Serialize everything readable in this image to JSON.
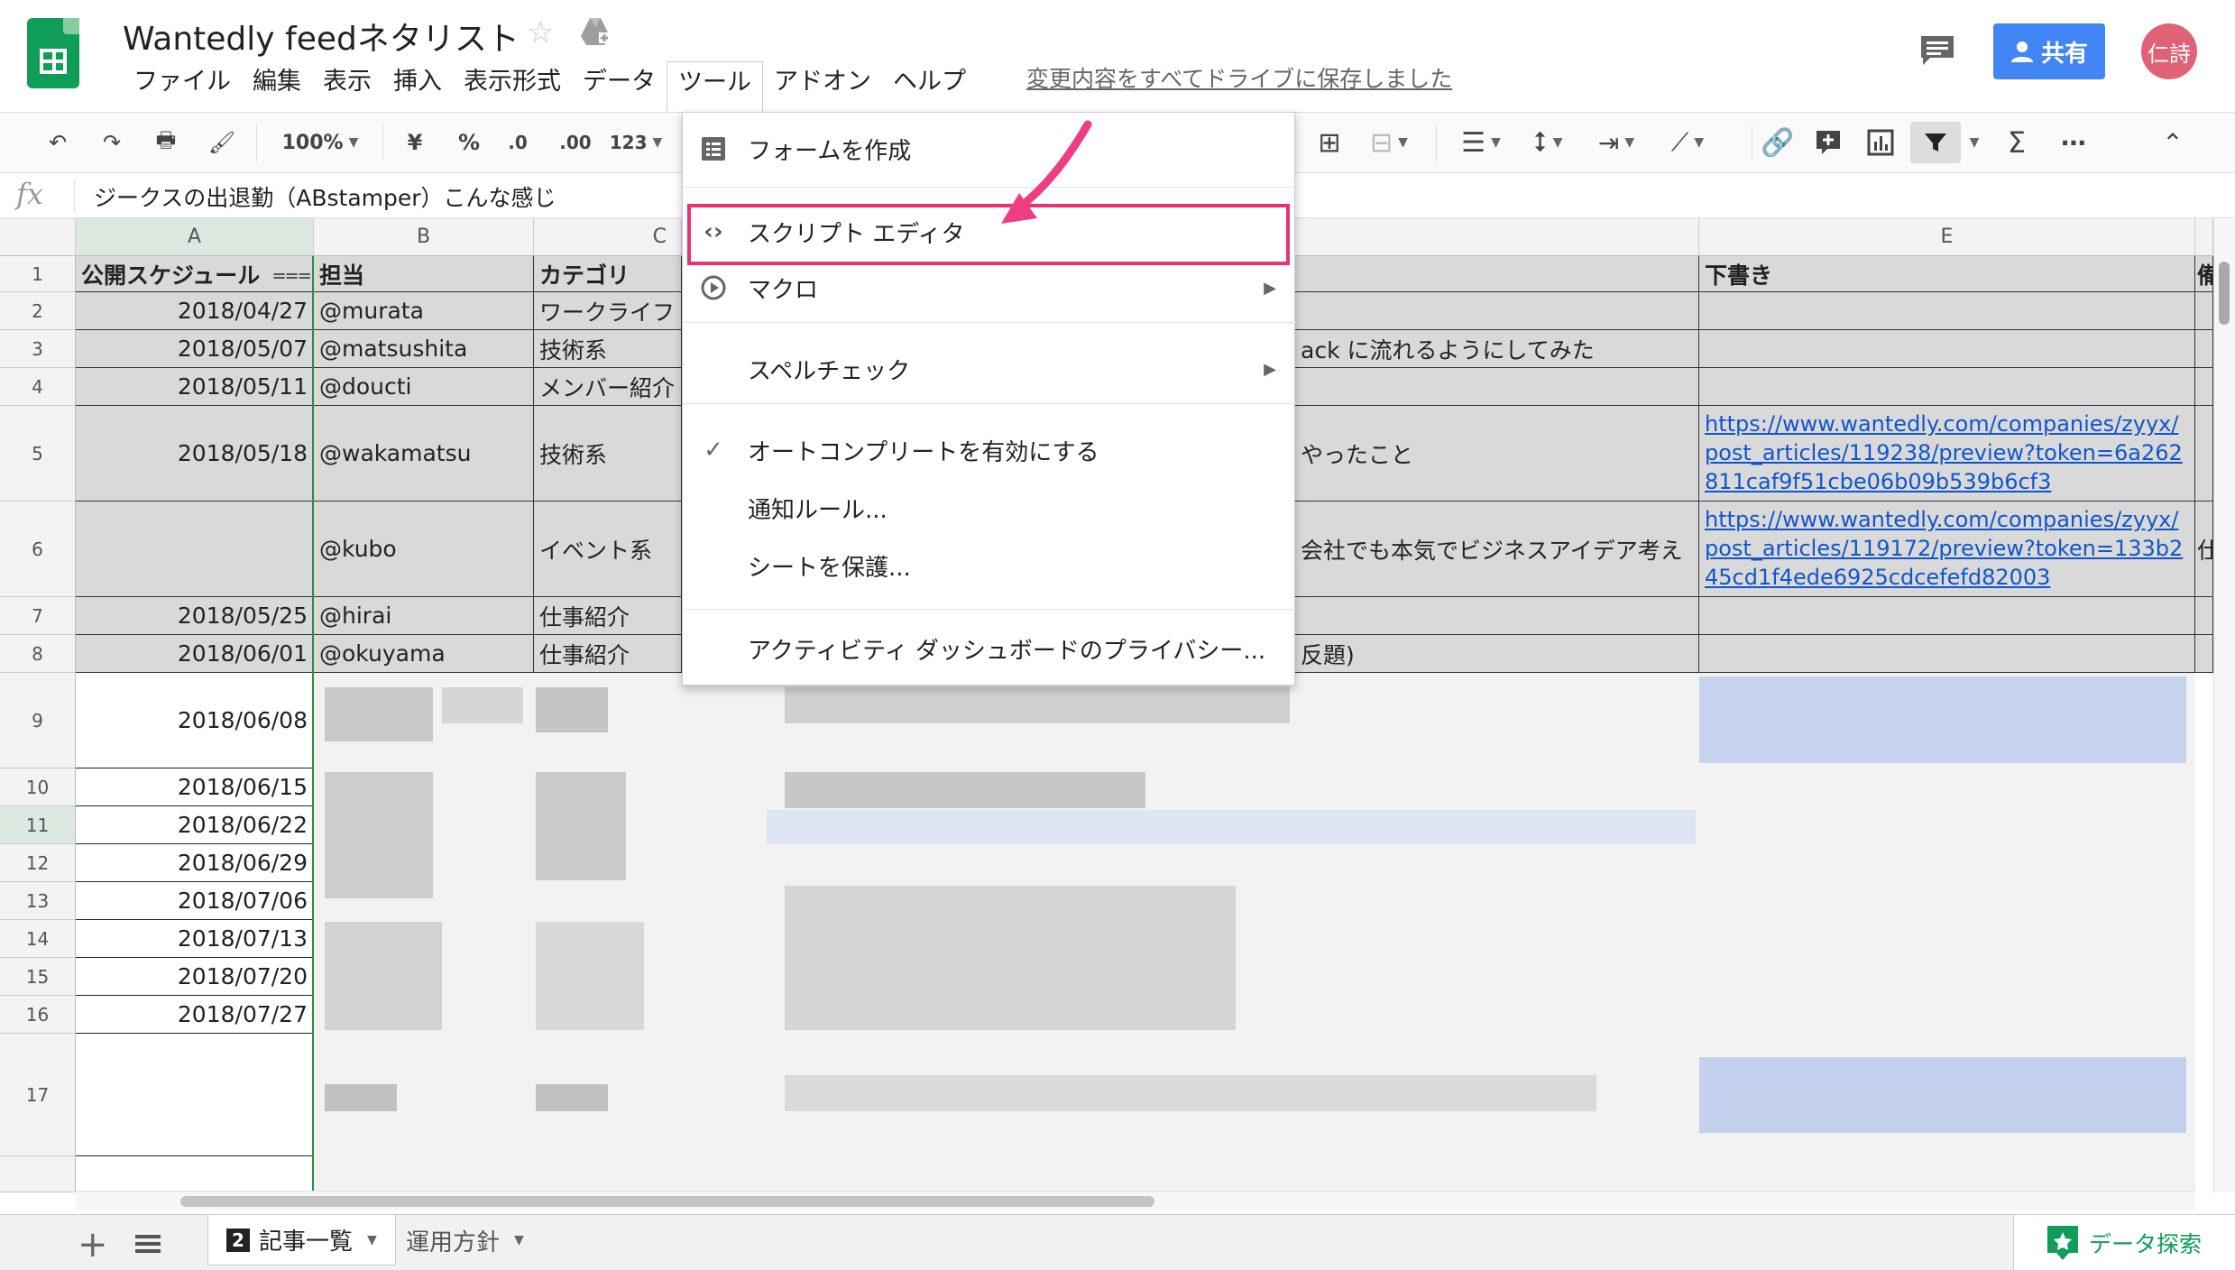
{
  "app": {
    "title": "Wantedly feedネタリスト",
    "save_status": "変更内容をすべてドライブに保存しました",
    "share_label": "共有",
    "avatar_text": "仁詩",
    "brand_color": "#0f9d58",
    "accent_color": "#4285f4"
  },
  "menubar": {
    "items": [
      "ファイル",
      "編集",
      "表示",
      "挿入",
      "表示形式",
      "データ",
      "ツール",
      "アドオン",
      "ヘルプ"
    ]
  },
  "toolbar": {
    "zoom": "100%",
    "currency": "¥",
    "percent": "%",
    "decrease_decimal": ".0",
    "increase_decimal": ".00",
    "more_formats": "123"
  },
  "formula": {
    "content": "ジークスの出退勤（ABstamper）こんな感じ"
  },
  "columns": [
    "A",
    "B",
    "C",
    "E"
  ],
  "rows": [
    "1",
    "2",
    "3",
    "4",
    "5",
    "6",
    "7",
    "8",
    "9",
    "10",
    "11",
    "12",
    "13",
    "14",
    "15",
    "16",
    "17"
  ],
  "header_row": {
    "a": "公開スケジュール",
    "b": "担当",
    "c": "カテゴリ",
    "e": "下書き",
    "f": "備"
  },
  "data_rows": [
    {
      "date": "2018/04/27",
      "owner": "@murata",
      "category": "ワークライフ",
      "title": "",
      "draft": ""
    },
    {
      "date": "2018/05/07",
      "owner": "@matsushita",
      "category": "技術系",
      "title": "ack に流れるようにしてみた",
      "draft": ""
    },
    {
      "date": "2018/05/11",
      "owner": "@doucti",
      "category": "メンバー紹介",
      "title": "",
      "draft": ""
    },
    {
      "date": "2018/05/18",
      "owner": "@wakamatsu",
      "category": "技術系",
      "title": "やったこと",
      "draft": "https://www.wantedly.com/companies/zyyx/post_articles/119238/preview?token=6a262811caf9f51cbe06b09b539b6cf3"
    },
    {
      "date": "",
      "owner": "@kubo",
      "category": "イベント系",
      "title": "会社でも本気でビジネスアイデア考え",
      "draft": "https://www.wantedly.com/companies/zyyx/post_articles/119172/preview?token=133b245cd1f4ede6925cdcefefd82003",
      "extra": "仕"
    },
    {
      "date": "2018/05/25",
      "owner": "@hirai",
      "category": "仕事紹介",
      "title": "",
      "draft": ""
    },
    {
      "date": "2018/06/01",
      "owner": "@okuyama",
      "category": "仕事紹介",
      "title": "反題)",
      "draft": ""
    }
  ],
  "later_dates": [
    "2018/06/08",
    "2018/06/15",
    "2018/06/22",
    "2018/06/29",
    "2018/07/06",
    "2018/07/13",
    "2018/07/20",
    "2018/07/27"
  ],
  "tools_menu": {
    "items": [
      {
        "label": "フォームを作成",
        "icon": "form-icon"
      },
      {
        "label": "スクリプト エディタ",
        "icon": "code-icon"
      },
      {
        "label": "マクロ",
        "icon": "play-circle-icon"
      },
      {
        "label": "スペルチェック",
        "icon": ""
      },
      {
        "label": "オートコンプリートを有効にする",
        "icon": "check-icon"
      },
      {
        "label": "通知ルール...",
        "icon": ""
      },
      {
        "label": "シートを保護...",
        "icon": ""
      },
      {
        "label": "アクティビティ ダッシュボードのプライバシー...",
        "icon": ""
      }
    ],
    "highlight_color": "#e8336f"
  },
  "sheets": {
    "tabs": [
      {
        "label": "記事一覧",
        "badge": "2"
      },
      {
        "label": "運用方針"
      }
    ],
    "explore_label": "データ探索"
  }
}
